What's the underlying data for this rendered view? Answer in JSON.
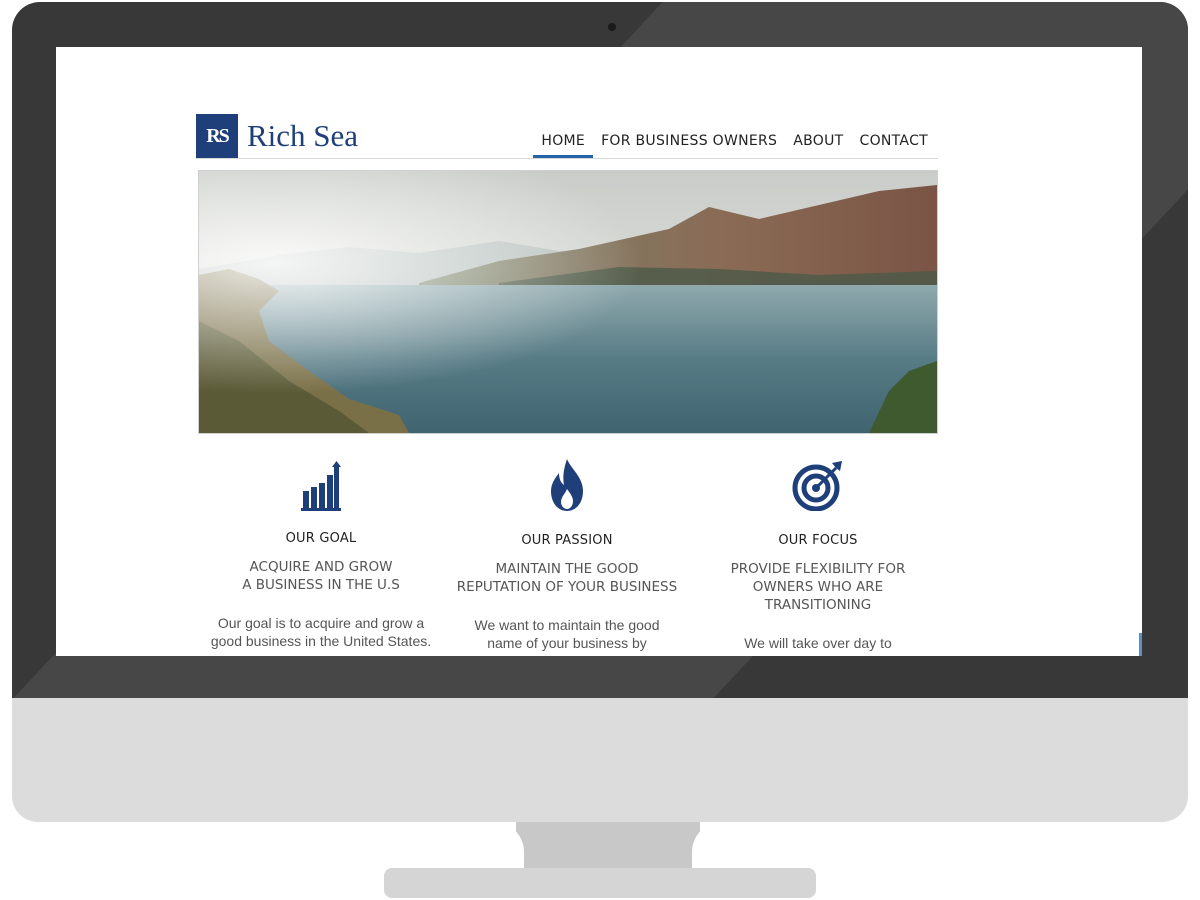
{
  "site": {
    "logo_mark": "RS",
    "logo_text": "Rich Sea"
  },
  "nav": {
    "items": [
      {
        "label": "HOME",
        "active": true
      },
      {
        "label": "FOR BUSINESS OWNERS",
        "active": false
      },
      {
        "label": "ABOUT",
        "active": false
      },
      {
        "label": "CONTACT",
        "active": false
      }
    ]
  },
  "hero": {
    "image": "lake-mountains-landscape"
  },
  "features": [
    {
      "icon": "bar-chart-growth-icon",
      "title": "OUR GOAL",
      "subtitle_lines": [
        "ACQUIRE AND GROW",
        "A BUSINESS IN THE U.S"
      ],
      "description_lines": [
        "Our goal is to acquire and grow a",
        "good business in the United States."
      ]
    },
    {
      "icon": "flame-icon",
      "title": "OUR PASSION",
      "subtitle_lines": [
        "MAINTAIN THE GOOD",
        "REPUTATION OF YOUR BUSINESS"
      ],
      "description_lines": [
        "We want to maintain the good",
        "name of your business by"
      ]
    },
    {
      "icon": "target-icon",
      "title": "OUR FOCUS",
      "subtitle_lines": [
        "PROVIDE FLEXIBILITY FOR",
        "OWNERS WHO ARE",
        "TRANSITIONING"
      ],
      "description_lines": [
        "We will take over day to"
      ]
    }
  ],
  "colors": {
    "brand": "#1e3f7a",
    "nav_active_underline": "#2563a8",
    "bezel": "#383838",
    "chin": "#dcdcdc"
  }
}
